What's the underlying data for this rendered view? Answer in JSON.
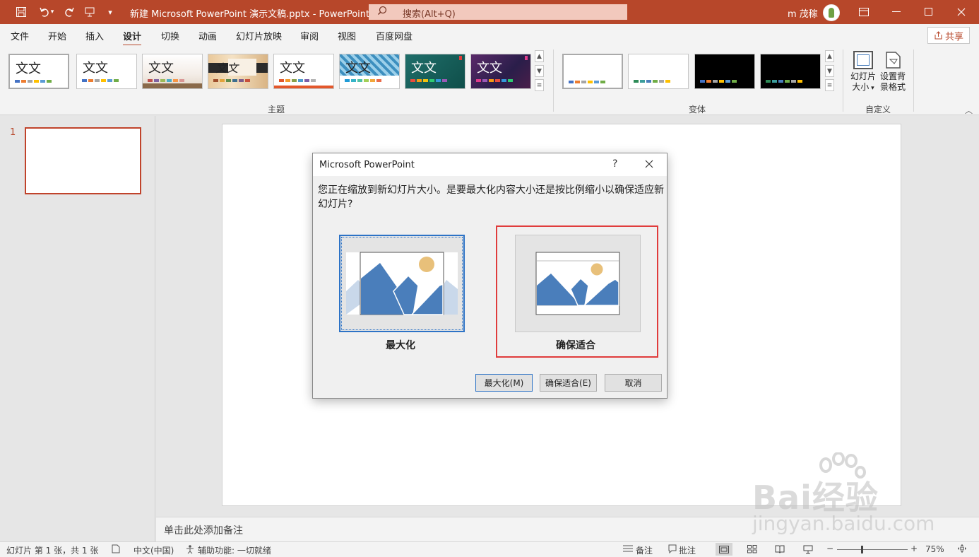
{
  "titlebar": {
    "doc_title": "新建 Microsoft PowerPoint 演示文稿.pptx  -  PowerPoint",
    "search_placeholder": "搜索(Alt+Q)",
    "user_name": "m 茂稼"
  },
  "tabs": [
    "文件",
    "开始",
    "插入",
    "设计",
    "切换",
    "动画",
    "幻灯片放映",
    "审阅",
    "视图",
    "百度网盘"
  ],
  "active_tab": "设计",
  "share_label": "共享",
  "ribbon": {
    "theme_sample_text": "文文",
    "themes_group_label": "主题",
    "variants_group_label": "变体",
    "customize_group_label": "自定义",
    "slide_size_label_1": "幻灯片",
    "slide_size_label_2": "大小",
    "bg_format_label_1": "设置背",
    "bg_format_label_2": "景格式"
  },
  "slide_pane": {
    "slide_number": "1"
  },
  "notes_placeholder": "单击此处添加备注",
  "status": {
    "slide_info": "幻灯片 第 1 张，共 1 张",
    "language": "中文(中国)",
    "accessibility": "辅助功能: 一切就绪",
    "notes_btn": "备注",
    "comments_btn": "批注",
    "zoom": "75%"
  },
  "dialog": {
    "title": "Microsoft PowerPoint",
    "help": "?",
    "message": "您正在缩放到新幻灯片大小。是要最大化内容大小还是按比例缩小以确保适应新幻灯片?",
    "option_maximize_label": "最大化",
    "option_fit_label": "确保适合",
    "btn_maximize": "最大化(M)",
    "btn_fit": "确保适合(E)",
    "btn_cancel": "取消"
  },
  "watermark": {
    "line1": "Bai经验",
    "line2": "jingyan.baidu.com"
  },
  "colors": {
    "accent": "#b7472a",
    "dialog_highlight": "#e03c3c",
    "selection_blue": "#2d73c6",
    "image_blue": "#4a7ebb",
    "sun": "#e8c07a"
  }
}
